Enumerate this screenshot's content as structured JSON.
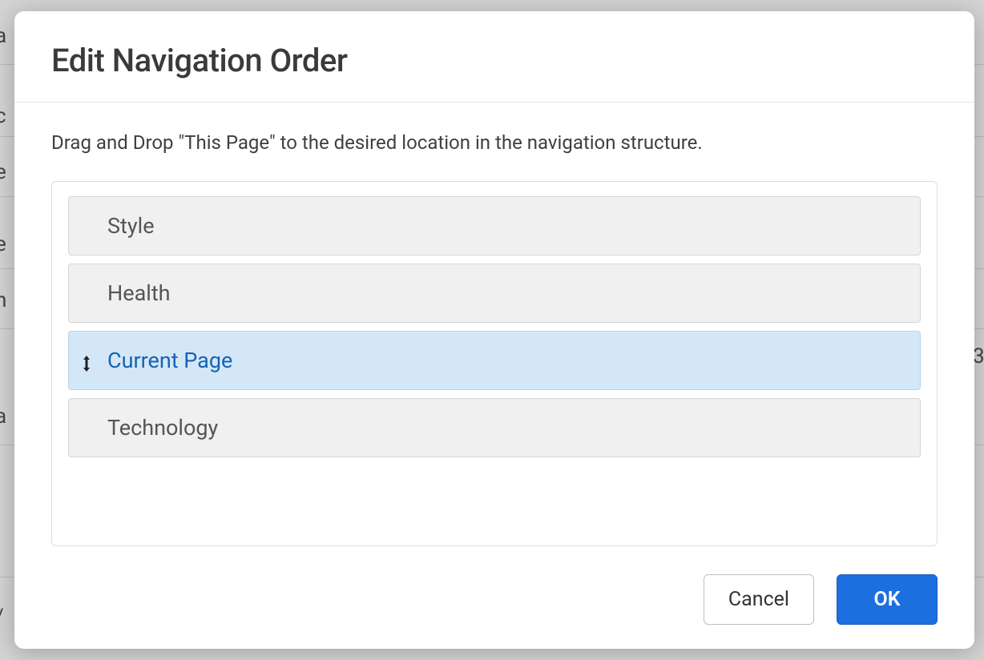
{
  "background": {
    "fragments": [
      "a",
      "c",
      "e",
      "e",
      "n",
      "3",
      "a",
      "/"
    ]
  },
  "modal": {
    "title": "Edit Navigation Order",
    "instruction": "Drag and Drop \"This Page\" to the desired location in the navigation structure.",
    "items": [
      {
        "label": "Style",
        "current": false
      },
      {
        "label": "Health",
        "current": false
      },
      {
        "label": "Current Page",
        "current": true
      },
      {
        "label": "Technology",
        "current": false
      }
    ],
    "buttons": {
      "cancel": "Cancel",
      "ok": "OK"
    }
  }
}
